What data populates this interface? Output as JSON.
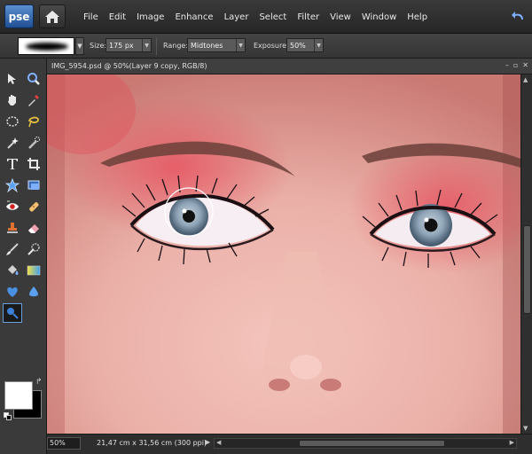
{
  "app": {
    "logo_text": "pse",
    "home_icon": "home-icon"
  },
  "menubar": {
    "items": [
      "File",
      "Edit",
      "Image",
      "Enhance",
      "Layer",
      "Select",
      "Filter",
      "View",
      "Window",
      "Help"
    ]
  },
  "options": {
    "size_label": "Size:",
    "size_value": "175 px",
    "range_label": "Range:",
    "range_value": "Midtones",
    "exposure_label": "Exposure:",
    "exposure_value": "50%"
  },
  "document": {
    "title": "IMG_5954.psd @ 50%(Layer 9 copy, RGB/8)",
    "window_buttons": [
      "–",
      "▫",
      "✕"
    ]
  },
  "status": {
    "zoom": "50%",
    "info": "21,47 cm x 31,56 cm (300 ppi)"
  },
  "tools": [
    "move-tool-icon",
    "zoom-tool-icon",
    "hand-tool-icon",
    "eyedropper-tool-icon",
    "marquee-tool-icon",
    "lasso-tool-icon",
    "magic-wand-tool-icon",
    "quick-selection-tool-icon",
    "type-tool-icon",
    "crop-tool-icon",
    "cookie-cutter-tool-icon",
    "straighten-tool-icon",
    "red-eye-tool-icon",
    "spot-healing-tool-icon",
    "clone-stamp-tool-icon",
    "eraser-tool-icon",
    "brush-tool-icon",
    "smart-brush-tool-icon",
    "paint-bucket-tool-icon",
    "gradient-tool-icon",
    "custom-shape-tool-icon",
    "blur-tool-icon",
    "dodge-tool-icon"
  ],
  "colors": {
    "foreground": "#ffffff",
    "background": "#000000",
    "accent": "#2a6fc9"
  }
}
